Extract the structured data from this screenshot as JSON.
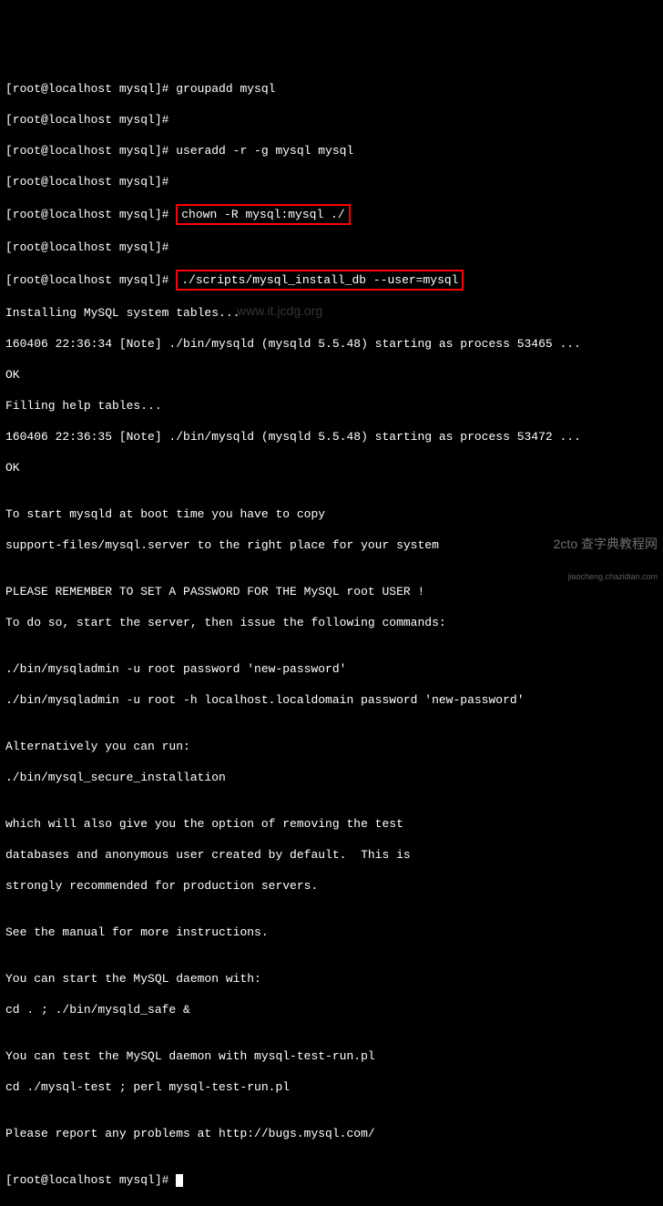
{
  "prompt": "[root@localhost mysql]# ",
  "cmd": {
    "groupadd": "groupadd mysql",
    "useradd": "useradd -r -g mysql mysql",
    "chown": "chown -R mysql:mysql ./",
    "install": "./scripts/mysql_install_db --user=mysql"
  },
  "out": {
    "l1": "Installing MySQL system tables...",
    "l2": "160406 22:36:34 [Note] ./bin/mysqld (mysqld 5.5.48) starting as process 53465 ...",
    "l3": "OK",
    "l4": "Filling help tables...",
    "l5": "160406 22:36:35 [Note] ./bin/mysqld (mysqld 5.5.48) starting as process 53472 ...",
    "l6": "OK",
    "l7": "",
    "l8": "To start mysqld at boot time you have to copy",
    "l9": "support-files/mysql.server to the right place for your system",
    "l10": "",
    "l11": "PLEASE REMEMBER TO SET A PASSWORD FOR THE MySQL root USER !",
    "l12": "To do so, start the server, then issue the following commands:",
    "l13": "",
    "l14": "./bin/mysqladmin -u root password 'new-password'",
    "l15": "./bin/mysqladmin -u root -h localhost.localdomain password 'new-password'",
    "l16": "",
    "l17": "Alternatively you can run:",
    "l18": "./bin/mysql_secure_installation",
    "l19": "",
    "l20": "which will also give you the option of removing the test",
    "l21": "databases and anonymous user created by default.  This is",
    "l22": "strongly recommended for production servers.",
    "l23": "",
    "l24": "See the manual for more instructions.",
    "l25": "",
    "l26": "You can start the MySQL daemon with:",
    "l27": "cd . ; ./bin/mysqld_safe &",
    "l28": "",
    "l29": "You can test the MySQL daemon with mysql-test-run.pl",
    "l30": "cd ./mysql-test ; perl mysql-test-run.pl",
    "l31": "",
    "l32": "Please report any problems at http://bugs.mysql.com/",
    "l33": ""
  },
  "watermark": {
    "mid": "www.it.jcdg.org",
    "main": "查字典教程网",
    "sub": "jiaocheng.chazidian.com",
    "corner": "2cto"
  }
}
